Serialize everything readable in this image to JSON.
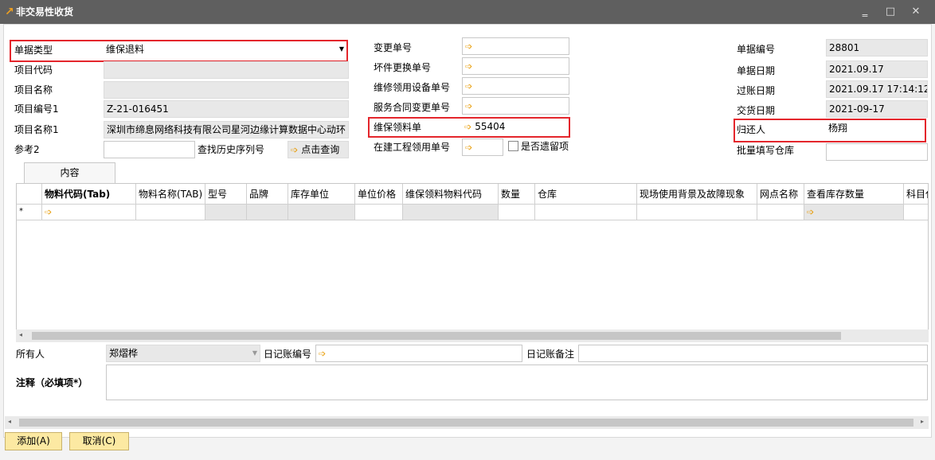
{
  "window": {
    "title": "非交易性收货",
    "minimize_glyph": "‗",
    "maximize_glyph": "□",
    "close_glyph": "✕"
  },
  "left": {
    "doc_type_label": "单据类型",
    "doc_type_value": "维保退料",
    "project_code_label": "项目代码",
    "project_name_label": "项目名称",
    "project_no1_label": "项目编号1",
    "project_no1_value": "Z-21-016451",
    "project_name1_label": "项目名称1",
    "project_name1_value": "深圳市缔息网络科技有限公司星河边缘计算数据中心动环",
    "ref2_label": "参考2",
    "history_serial_label": "查找历史序列号",
    "query_button": "点击查询"
  },
  "middle": {
    "change_no_label": "变更单号",
    "part_replace_no_label": "坏件更换单号",
    "repair_equip_no_label": "维修领用设备单号",
    "service_contract_no_label": "服务合同变更单号",
    "maint_requisition_label": "维保领料单",
    "maint_requisition_value": "55404",
    "construction_req_label": "在建工程领用单号",
    "leftover_checkbox_label": "是否遗留项"
  },
  "right": {
    "doc_no_label": "单据编号",
    "doc_no_value": "28801",
    "doc_date_label": "单据日期",
    "doc_date_value": "2021.09.17",
    "posting_date_label": "过账日期",
    "posting_date_value": "2021.09.17 17:14:12",
    "delivery_date_label": "交货日期",
    "delivery_date_value": "2021-09-17",
    "returner_label": "归还人",
    "returner_value": "杨翔",
    "batch_warehouse_label": "批量填写仓库"
  },
  "tabs": [
    "内容"
  ],
  "grid": {
    "columns": [
      "物料代码(Tab)",
      "物料名称(TAB)",
      "型号",
      "品牌",
      "库存单位",
      "单位价格",
      "维保领料物料代码",
      "数量",
      "仓库",
      "现场使用背景及故障现象",
      "网点名称",
      "查看库存数量",
      "科目代"
    ],
    "new_row_marker": "*"
  },
  "bottom": {
    "owner_label": "所有人",
    "owner_value": "郑熠桦",
    "journal_no_label": "日记账编号",
    "journal_note_label": "日记账备注",
    "remarks_label": "注释（必填项*）"
  },
  "buttons": {
    "add": "添加(A)",
    "cancel": "取消(C)"
  }
}
